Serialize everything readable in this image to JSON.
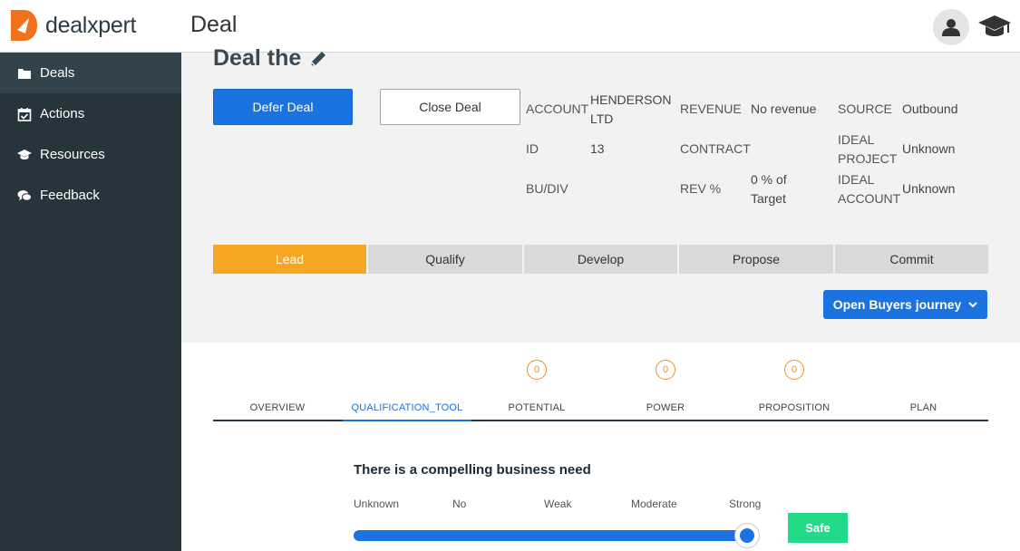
{
  "app": {
    "name": "dealxpert",
    "page_heading": "Deal"
  },
  "sidebar": {
    "items": [
      {
        "label": "Deals",
        "icon": "folder-icon"
      },
      {
        "label": "Actions",
        "icon": "calendar-check-icon"
      },
      {
        "label": "Resources",
        "icon": "graduation-cap-icon"
      },
      {
        "label": "Feedback",
        "icon": "comments-icon"
      }
    ]
  },
  "deal": {
    "title": "Deal the",
    "defer_label": "Defer Deal",
    "close_label": "Close Deal",
    "fields": {
      "account_label": "ACCOUNT",
      "account_value_line1": "HENDERSON",
      "account_value_line2": "LTD",
      "revenue_label": "REVENUE",
      "revenue_value": "No revenue",
      "source_label": "SOURCE",
      "source_value": "Outbound",
      "id_label": "ID",
      "id_value": "13",
      "contract_label": "CONTRACT",
      "ideal_project_label_line1": "IDEAL",
      "ideal_project_label_line2": "PROJECT",
      "ideal_project_value": "Unknown",
      "budiv_label": "BU/DIV",
      "rev_pct_label": "REV %",
      "rev_pct_value_line1": "0 % of",
      "rev_pct_value_line2": "Target",
      "ideal_account_label_line1": "IDEAL",
      "ideal_account_label_line2": "ACCOUNT",
      "ideal_account_value": "Unknown"
    }
  },
  "stages": [
    "Lead",
    "Qualify",
    "Develop",
    "Propose",
    "Commit"
  ],
  "active_stage": "Lead",
  "journey_button": "Open Buyers journey",
  "tabs": [
    {
      "label": "OVERVIEW",
      "badge": ""
    },
    {
      "label": "QUALIFICATION_TOOL",
      "badge": ""
    },
    {
      "label": "POTENTIAL",
      "badge": "0"
    },
    {
      "label": "POWER",
      "badge": "0"
    },
    {
      "label": "PROPOSITION",
      "badge": "0"
    },
    {
      "label": "PLAN",
      "badge": ""
    }
  ],
  "active_tab": "QUALIFICATION_TOOL",
  "question": {
    "text": "There is a compelling business need",
    "scale": [
      "Unknown",
      "No",
      "Weak",
      "Moderate",
      "Strong"
    ],
    "selected": "Strong",
    "slider_value_fraction": 1.0,
    "status": "Safe"
  },
  "colors": {
    "accent": "#1a73e0",
    "sidebar": "#27343c",
    "active_stage": "#f5a623",
    "safe": "#23d98a",
    "badge": "#e8912e"
  }
}
